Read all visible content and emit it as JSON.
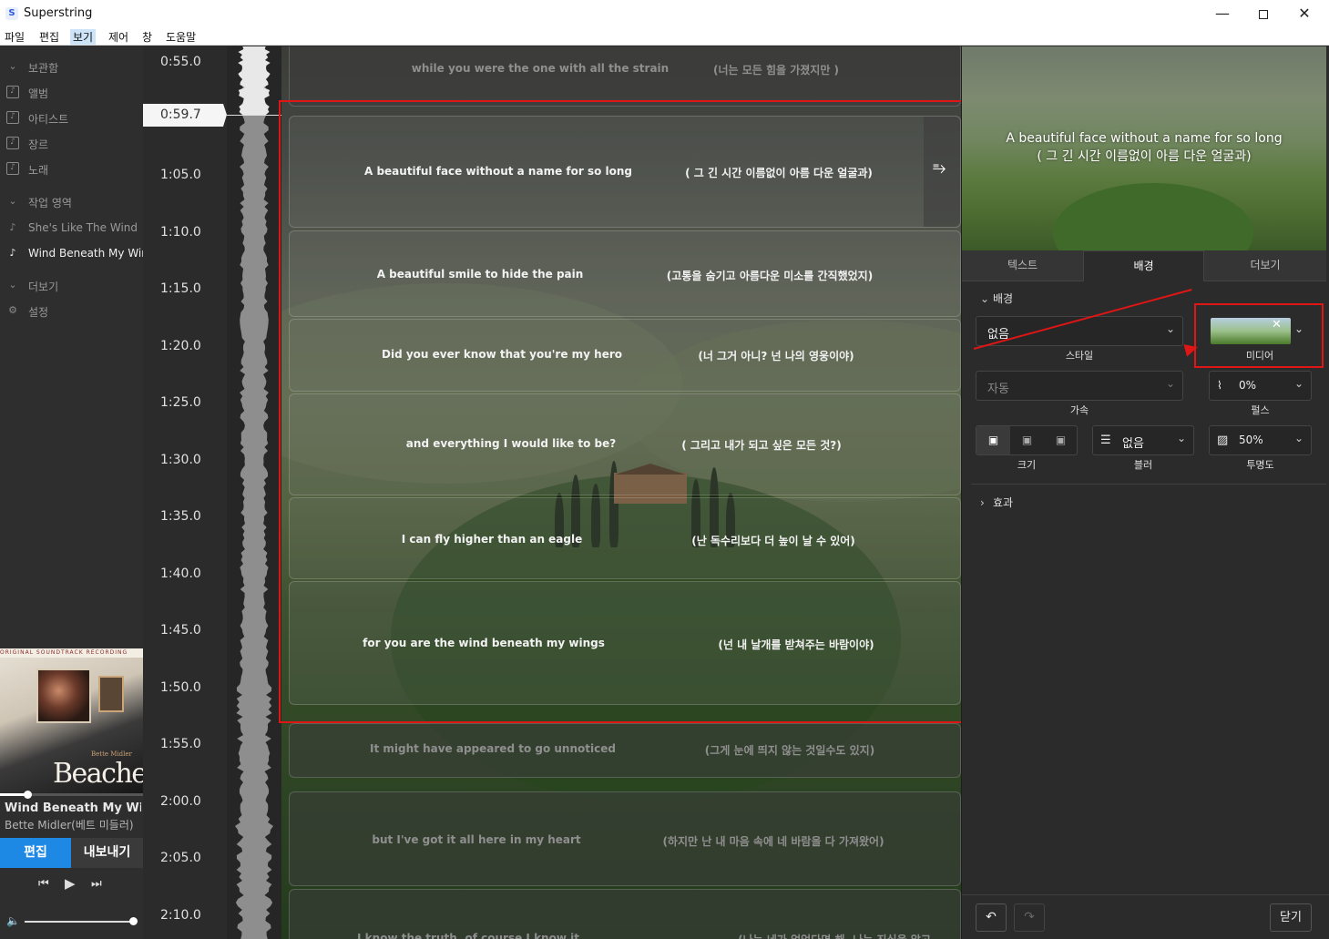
{
  "window": {
    "title": "Superstring",
    "app_icon": "S"
  },
  "menu": [
    "파일",
    "편집",
    "보기",
    "제어",
    "창",
    "도움말"
  ],
  "sidebar": {
    "items": [
      {
        "label": "보관함",
        "icon": "chevron-down-icon"
      },
      {
        "label": "앨범",
        "icon": "album-icon"
      },
      {
        "label": "아티스트",
        "icon": "artist-icon"
      },
      {
        "label": "장르",
        "icon": "genre-icon"
      },
      {
        "label": "노래",
        "icon": "song-icon"
      },
      {
        "label": "작업 영역",
        "icon": "chevron-down-icon"
      },
      {
        "label": "She's Like The Wind",
        "icon": "music-note-icon"
      },
      {
        "label": "Wind Beneath My Wings",
        "icon": "music-note-icon"
      },
      {
        "label": "더보기",
        "icon": "chevron-down-icon"
      },
      {
        "label": "설정",
        "icon": "gear-icon"
      }
    ]
  },
  "now_playing": {
    "album_band": "ORIGINAL SOUNDTRACK RECORDING",
    "album_artist": "Bette Midler",
    "album_title": "Beaches",
    "title": "Wind Beneath My Wings",
    "artist": "Bette Midler(베트 미들러)",
    "progress": 0.19,
    "volume": 1.0
  },
  "actions": {
    "edit": "편집",
    "export": "내보내기"
  },
  "transport": {
    "prev": "⏮",
    "play": "▶",
    "next": "⏭",
    "volume": "🔈"
  },
  "timeline": {
    "current": "0:59.7",
    "labels": [
      "0:55.0",
      "1:05.0",
      "1:10.0",
      "1:15.0",
      "1:20.0",
      "1:25.0",
      "1:30.0",
      "1:35.0",
      "1:40.0",
      "1:45.0",
      "1:50.0",
      "1:55.0",
      "2:00.0",
      "2:05.0",
      "2:10.0"
    ]
  },
  "lyrics": [
    {
      "en": "while you were the one with all the strain",
      "ko": "(너는 모든 힘을 가졌지만 )"
    },
    {
      "en": "A beautiful face without a name for so long",
      "ko": "( 그 긴 시간 이름없이 아름 다운 얼굴과)"
    },
    {
      "en": "A beautiful smile to hide the pain",
      "ko": "(고통을 숨기고 아름다운 미소를 간직했었지)"
    },
    {
      "en": "Did you ever know that you're my hero",
      "ko": "(너 그거 아니? 넌 나의 영웅이야)"
    },
    {
      "en": "and everything I would like to be?",
      "ko": "( 그리고 내가 되고 싶은 모든 것?)"
    },
    {
      "en": "I can fly higher than an eagle",
      "ko": "(난 독수리보다 더 높이 날 수 있어)"
    },
    {
      "en": "for you are the wind beneath my wings",
      "ko": "(넌 내 날개를 받쳐주는 바람이야)"
    },
    {
      "en": "It might have appeared to go unnoticed",
      "ko": "(그게 눈에 띄지 않는 것일수도 있지)"
    },
    {
      "en": "but I've got it all here in my heart",
      "ko": "(하지만 난 내 마음 속에 네 바람을 다 가져왔어)"
    },
    {
      "en": "I know the truth, of course I know it",
      "ko": "(나는 네가 없었다면 해, 나는 진실을 알고"
    }
  ],
  "preview": {
    "line1": "A beautiful face without a name for so long",
    "line2": "( 그 긴 시간 이름없이 아름 다운 얼굴과)"
  },
  "panel": {
    "tabs": [
      "텍스트",
      "배경",
      "더보기"
    ],
    "active_tab": "배경",
    "section_background": "배경",
    "style_value": "없음",
    "style_label": "스타일",
    "media_label": "미디어",
    "accel_value": "자동",
    "accel_label": "가속",
    "pulse_value": "0%",
    "pulse_label": "펄스",
    "size_label": "크기",
    "blur_value": "없음",
    "blur_label": "블러",
    "opacity_value": "50%",
    "opacity_label": "투명도",
    "section_effects": "효과",
    "close": "닫기"
  },
  "colors": {
    "accent": "#1e88e5",
    "annotation": "#e01515"
  }
}
